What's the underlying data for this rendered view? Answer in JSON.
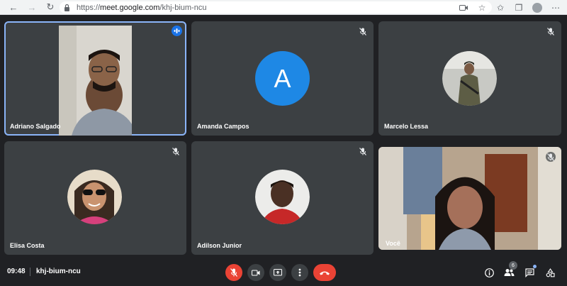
{
  "browser": {
    "url_prefix": "https://",
    "url_host": "meet.google.com",
    "url_path": "/khj-bium-ncu"
  },
  "participants": [
    {
      "name": "Adriano Salgado",
      "speaking": true
    },
    {
      "name": "Amanda Campos",
      "avatar_letter": "A",
      "avatar_color": "#1e88e5",
      "muted": true
    },
    {
      "name": "Marcelo Lessa",
      "muted": true
    },
    {
      "name": "Elisa Costa",
      "muted": true
    },
    {
      "name": "Adilson Junior",
      "muted": true
    },
    {
      "name": "Você",
      "muted": true
    }
  ],
  "bottom_bar": {
    "time": "09:48",
    "meeting_code": "khj-bium-ncu",
    "people_count": "6"
  },
  "colors": {
    "background": "#202124",
    "tile": "#3c4043",
    "accent": "#8ab4f8",
    "danger": "#ea4335"
  }
}
